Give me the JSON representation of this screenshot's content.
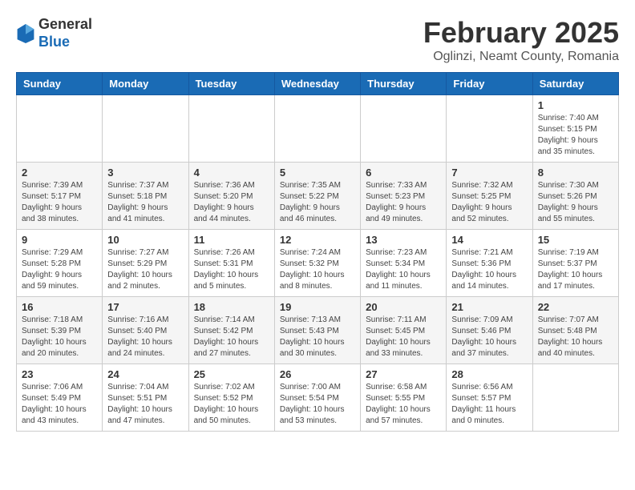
{
  "header": {
    "logo_general": "General",
    "logo_blue": "Blue",
    "title": "February 2025",
    "subtitle": "Oglinzi, Neamt County, Romania"
  },
  "calendar": {
    "days_of_week": [
      "Sunday",
      "Monday",
      "Tuesday",
      "Wednesday",
      "Thursday",
      "Friday",
      "Saturday"
    ],
    "weeks": [
      [
        {
          "day": "",
          "info": ""
        },
        {
          "day": "",
          "info": ""
        },
        {
          "day": "",
          "info": ""
        },
        {
          "day": "",
          "info": ""
        },
        {
          "day": "",
          "info": ""
        },
        {
          "day": "",
          "info": ""
        },
        {
          "day": "1",
          "info": "Sunrise: 7:40 AM\nSunset: 5:15 PM\nDaylight: 9 hours and 35 minutes."
        }
      ],
      [
        {
          "day": "2",
          "info": "Sunrise: 7:39 AM\nSunset: 5:17 PM\nDaylight: 9 hours and 38 minutes."
        },
        {
          "day": "3",
          "info": "Sunrise: 7:37 AM\nSunset: 5:18 PM\nDaylight: 9 hours and 41 minutes."
        },
        {
          "day": "4",
          "info": "Sunrise: 7:36 AM\nSunset: 5:20 PM\nDaylight: 9 hours and 44 minutes."
        },
        {
          "day": "5",
          "info": "Sunrise: 7:35 AM\nSunset: 5:22 PM\nDaylight: 9 hours and 46 minutes."
        },
        {
          "day": "6",
          "info": "Sunrise: 7:33 AM\nSunset: 5:23 PM\nDaylight: 9 hours and 49 minutes."
        },
        {
          "day": "7",
          "info": "Sunrise: 7:32 AM\nSunset: 5:25 PM\nDaylight: 9 hours and 52 minutes."
        },
        {
          "day": "8",
          "info": "Sunrise: 7:30 AM\nSunset: 5:26 PM\nDaylight: 9 hours and 55 minutes."
        }
      ],
      [
        {
          "day": "9",
          "info": "Sunrise: 7:29 AM\nSunset: 5:28 PM\nDaylight: 9 hours and 59 minutes."
        },
        {
          "day": "10",
          "info": "Sunrise: 7:27 AM\nSunset: 5:29 PM\nDaylight: 10 hours and 2 minutes."
        },
        {
          "day": "11",
          "info": "Sunrise: 7:26 AM\nSunset: 5:31 PM\nDaylight: 10 hours and 5 minutes."
        },
        {
          "day": "12",
          "info": "Sunrise: 7:24 AM\nSunset: 5:32 PM\nDaylight: 10 hours and 8 minutes."
        },
        {
          "day": "13",
          "info": "Sunrise: 7:23 AM\nSunset: 5:34 PM\nDaylight: 10 hours and 11 minutes."
        },
        {
          "day": "14",
          "info": "Sunrise: 7:21 AM\nSunset: 5:36 PM\nDaylight: 10 hours and 14 minutes."
        },
        {
          "day": "15",
          "info": "Sunrise: 7:19 AM\nSunset: 5:37 PM\nDaylight: 10 hours and 17 minutes."
        }
      ],
      [
        {
          "day": "16",
          "info": "Sunrise: 7:18 AM\nSunset: 5:39 PM\nDaylight: 10 hours and 20 minutes."
        },
        {
          "day": "17",
          "info": "Sunrise: 7:16 AM\nSunset: 5:40 PM\nDaylight: 10 hours and 24 minutes."
        },
        {
          "day": "18",
          "info": "Sunrise: 7:14 AM\nSunset: 5:42 PM\nDaylight: 10 hours and 27 minutes."
        },
        {
          "day": "19",
          "info": "Sunrise: 7:13 AM\nSunset: 5:43 PM\nDaylight: 10 hours and 30 minutes."
        },
        {
          "day": "20",
          "info": "Sunrise: 7:11 AM\nSunset: 5:45 PM\nDaylight: 10 hours and 33 minutes."
        },
        {
          "day": "21",
          "info": "Sunrise: 7:09 AM\nSunset: 5:46 PM\nDaylight: 10 hours and 37 minutes."
        },
        {
          "day": "22",
          "info": "Sunrise: 7:07 AM\nSunset: 5:48 PM\nDaylight: 10 hours and 40 minutes."
        }
      ],
      [
        {
          "day": "23",
          "info": "Sunrise: 7:06 AM\nSunset: 5:49 PM\nDaylight: 10 hours and 43 minutes."
        },
        {
          "day": "24",
          "info": "Sunrise: 7:04 AM\nSunset: 5:51 PM\nDaylight: 10 hours and 47 minutes."
        },
        {
          "day": "25",
          "info": "Sunrise: 7:02 AM\nSunset: 5:52 PM\nDaylight: 10 hours and 50 minutes."
        },
        {
          "day": "26",
          "info": "Sunrise: 7:00 AM\nSunset: 5:54 PM\nDaylight: 10 hours and 53 minutes."
        },
        {
          "day": "27",
          "info": "Sunrise: 6:58 AM\nSunset: 5:55 PM\nDaylight: 10 hours and 57 minutes."
        },
        {
          "day": "28",
          "info": "Sunrise: 6:56 AM\nSunset: 5:57 PM\nDaylight: 11 hours and 0 minutes."
        },
        {
          "day": "",
          "info": ""
        }
      ]
    ]
  }
}
